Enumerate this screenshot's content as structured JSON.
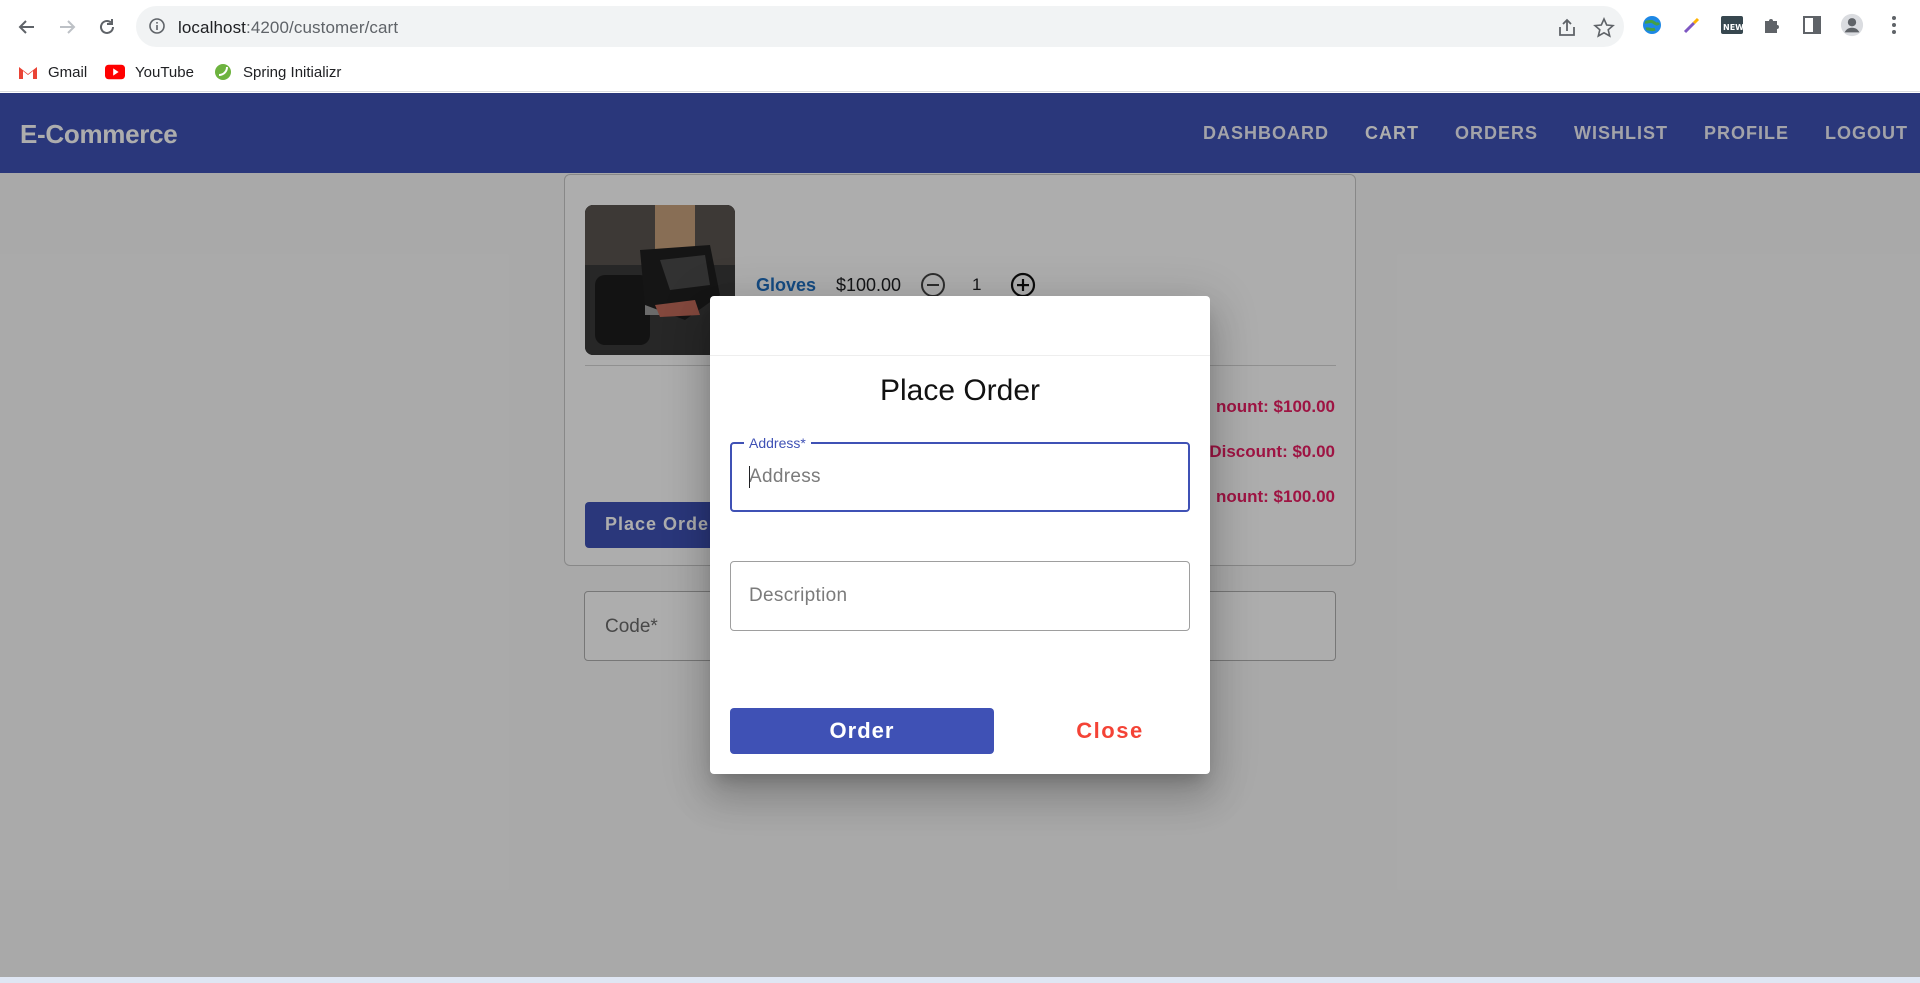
{
  "browser": {
    "url_host": "localhost",
    "url_path": ":4200/customer/cart",
    "bookmarks": [
      {
        "label": "Gmail",
        "icon": "gmail-icon"
      },
      {
        "label": "YouTube",
        "icon": "youtube-icon"
      },
      {
        "label": "Spring Initializr",
        "icon": "spring-icon"
      }
    ]
  },
  "header": {
    "brand": "E-Commerce",
    "nav": [
      "DASHBOARD",
      "CART",
      "ORDERS",
      "WISHLIST",
      "PROFILE",
      "LOGOUT"
    ],
    "active": "CART",
    "color": "#3f51b5"
  },
  "cart": {
    "item": {
      "name": "Gloves",
      "price": "$100.00",
      "quantity": "1"
    },
    "summary": {
      "total_amount": "nount: $100.00",
      "discount": "Discount: $0.00",
      "amount": "nount: $100.00"
    },
    "place_order_label": "Place Order",
    "coupon_placeholder": "Code*"
  },
  "dialog": {
    "title": "Place Order",
    "address_label": "Address*",
    "address_placeholder": "Address",
    "address_value": "",
    "description_placeholder": "Description",
    "description_value": "",
    "order_label": "Order",
    "close_label": "Close"
  },
  "colors": {
    "primary": "#3f51b5",
    "accent_pink": "#e91e63",
    "warn": "#f44336",
    "link": "#1f6fc0"
  }
}
